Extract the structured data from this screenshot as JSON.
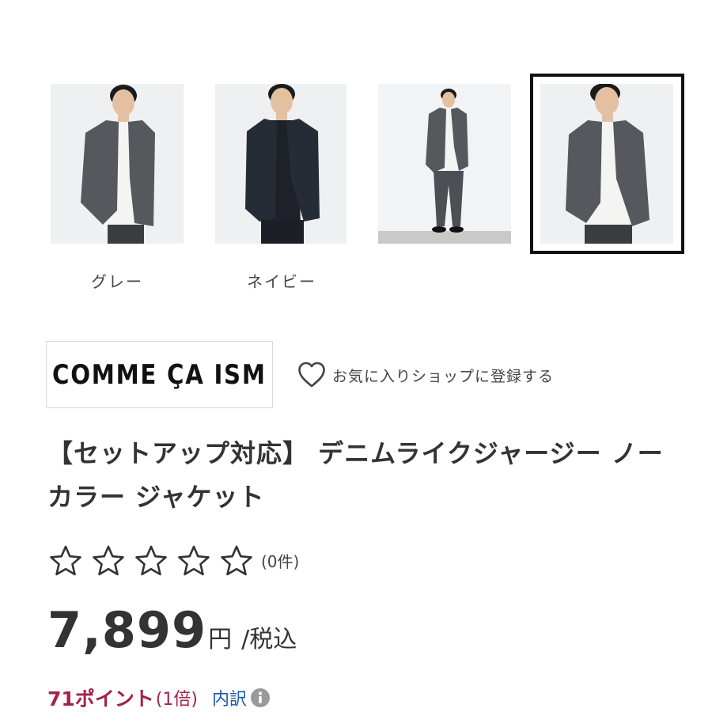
{
  "gallery": {
    "thumbnails": [
      {
        "label": "グレー",
        "jacket_color": "#55585d",
        "inner_color": "#f4f4f2",
        "selected": false
      },
      {
        "label": "ネイビー",
        "jacket_color": "#262c36",
        "inner_color": "#1e2228",
        "selected": false
      },
      {
        "label": "",
        "jacket_color": "#55585d",
        "inner_color": "#f4f4f2",
        "selected": false
      },
      {
        "label": "",
        "jacket_color": "#55585d",
        "inner_color": "#f4f4f2",
        "selected": true
      }
    ]
  },
  "brand": {
    "logo_text": "COMME ÇA ISM",
    "favorite_shop_label": "お気に入りショップに登録する",
    "heart_icon": "heart-outline-icon"
  },
  "product": {
    "title": "【セットアップ対応】 デニムライクジャージー ノーカラー ジャケット"
  },
  "rating": {
    "stars_filled": 0,
    "stars_total": 5,
    "review_count": "(0件)"
  },
  "price": {
    "value": "7,899",
    "unit": "円",
    "tax_label": "/税込"
  },
  "points": {
    "value": "71ポイント",
    "rate": "(1倍)",
    "breakdown_label": "内訳",
    "info_icon": "info-circle-icon"
  },
  "colors": {
    "points_accent": "#a3224a",
    "link_blue": "#1a5aa8",
    "selected_border": "#111111"
  }
}
